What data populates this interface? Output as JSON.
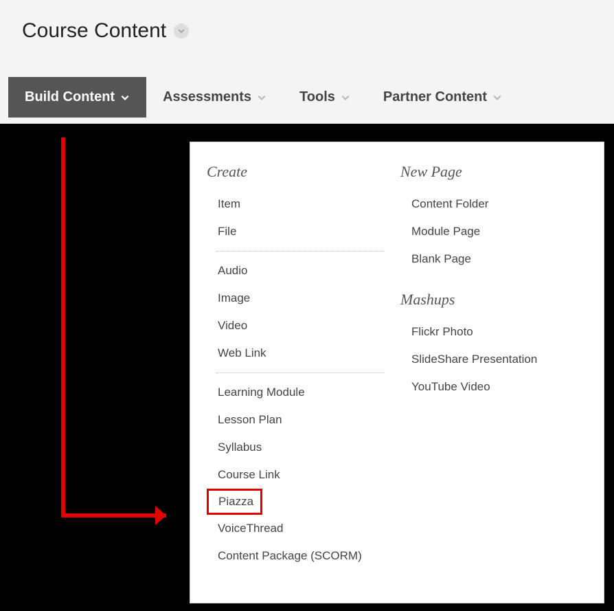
{
  "header": {
    "page_title": "Course Content"
  },
  "toolbar": {
    "tabs": [
      {
        "label": "Build Content",
        "active": true
      },
      {
        "label": "Assessments",
        "active": false
      },
      {
        "label": "Tools",
        "active": false
      },
      {
        "label": "Partner Content",
        "active": false
      }
    ]
  },
  "dropdown": {
    "columns": [
      {
        "sections": [
          {
            "heading": "Create",
            "items": [
              "Item",
              "File"
            ]
          },
          {
            "items": [
              "Audio",
              "Image",
              "Video",
              "Web Link"
            ]
          },
          {
            "items": [
              "Learning Module",
              "Lesson Plan",
              "Syllabus",
              "Course Link",
              "Piazza",
              "VoiceThread",
              "Content Package (SCORM)"
            ]
          }
        ]
      },
      {
        "sections": [
          {
            "heading": "New Page",
            "items": [
              "Content Folder",
              "Module Page",
              "Blank Page"
            ]
          },
          {
            "heading": "Mashups",
            "items": [
              "Flickr Photo",
              "SlideShare Presentation",
              "YouTube Video"
            ]
          }
        ]
      }
    ]
  },
  "annotation": {
    "highlighted_item": "Piazza",
    "arrow_color": "#e20000"
  }
}
